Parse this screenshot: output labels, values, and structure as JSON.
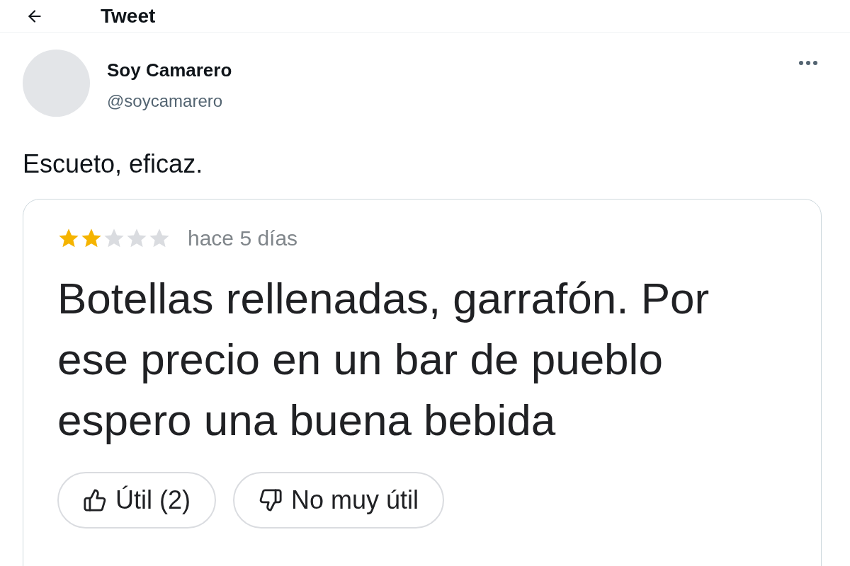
{
  "header": {
    "title": "Tweet"
  },
  "tweet": {
    "author": {
      "name": "Soy Camarero",
      "handle": "@soycamarero"
    },
    "text": "Escueto, eficaz.",
    "quoted_review": {
      "stars": 2,
      "time": "hace 5 días",
      "text": "Botellas rellenadas, garrafón. Por ese precio en un bar de pueblo espero una buena bebida",
      "buttons": [
        {
          "kind": "up",
          "label": "Útil (2)"
        },
        {
          "kind": "down",
          "label": "No muy útil"
        }
      ]
    }
  }
}
